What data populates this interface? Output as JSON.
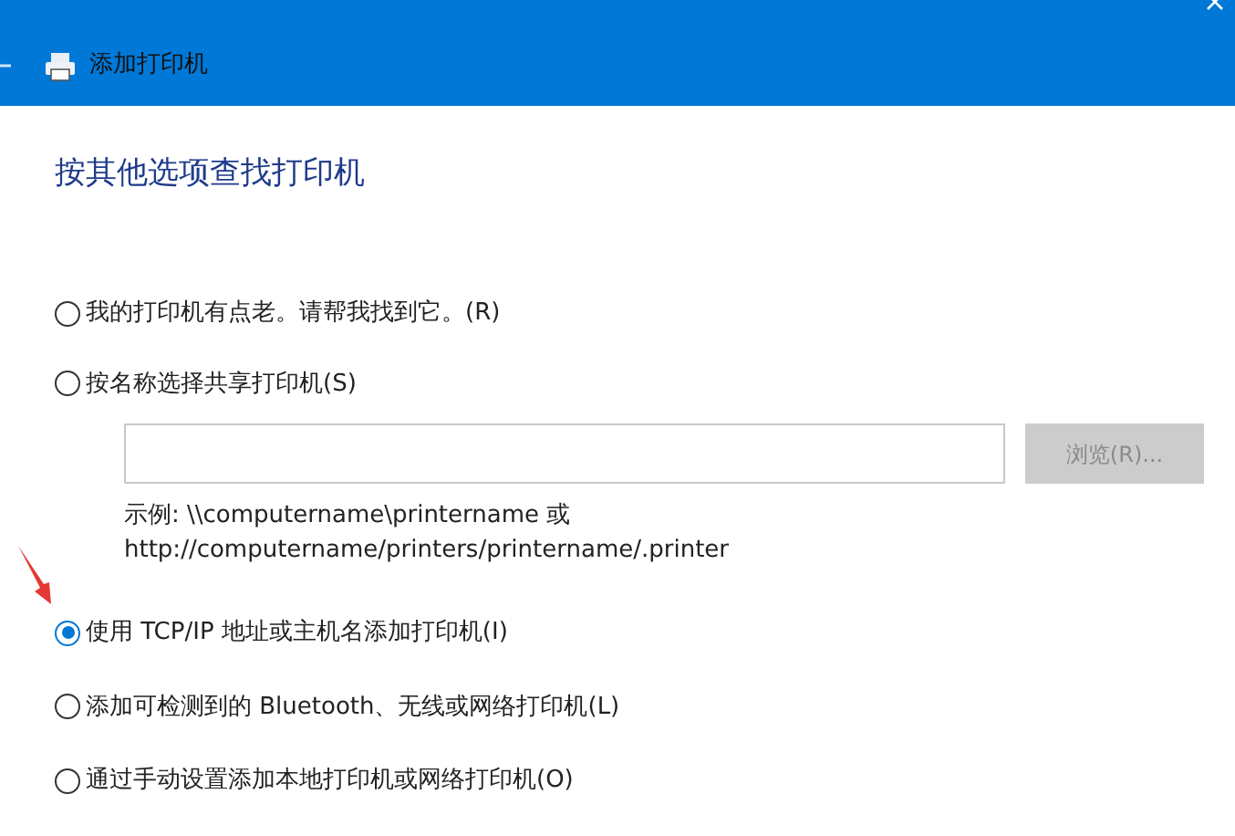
{
  "window": {
    "title": "添加打印机"
  },
  "heading": "按其他选项查找打印机",
  "options": [
    {
      "kind": "plain",
      "label": "我的打印机有点老。请帮我找到它。(R)",
      "selected": false
    },
    {
      "kind": "share",
      "label": "按名称选择共享打印机(S)",
      "selected": false,
      "browse": {
        "label": "浏览(R)...",
        "disabled": true
      },
      "example_lines": [
        "示例: \\\\computername\\printername 或",
        "http://computername/printers/printername/.printer"
      ]
    },
    {
      "kind": "plain",
      "label": "使用 TCP/IP 地址或主机名添加打印机(I)",
      "selected": true
    },
    {
      "kind": "plain",
      "label": "添加可检测到的 Bluetooth、无线或网络打印机(L)",
      "selected": false
    },
    {
      "kind": "plain",
      "label": "通过手动设置添加本地打印机或网络打印机(O)",
      "selected": false
    }
  ]
}
